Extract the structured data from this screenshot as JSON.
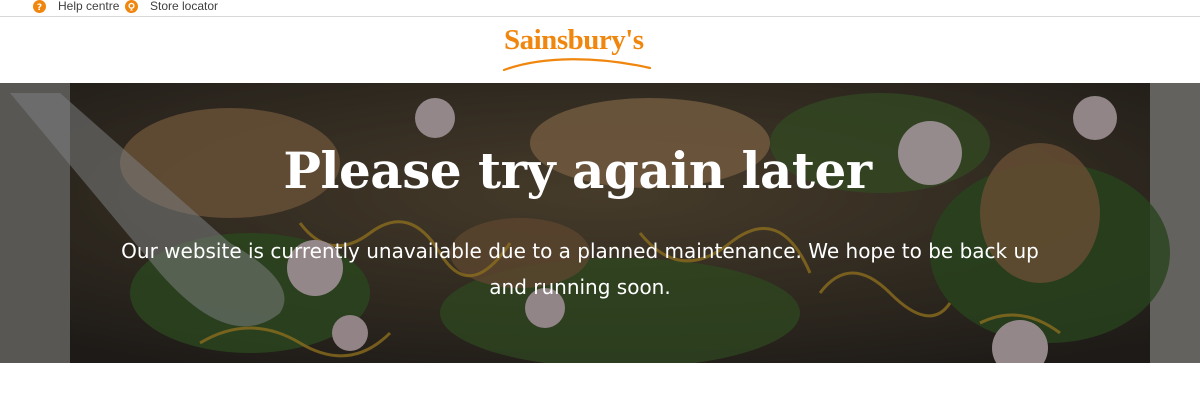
{
  "top_bar": {
    "help_label": "Help centre",
    "store_label": "Store locator"
  },
  "header": {
    "logo_text": "Sainsbury's",
    "brand_color": "#f0860e"
  },
  "hero": {
    "title": "Please try again later",
    "message": "Our website is currently unavailable due to a planned maintenance. We hope to be back up and running soon."
  }
}
